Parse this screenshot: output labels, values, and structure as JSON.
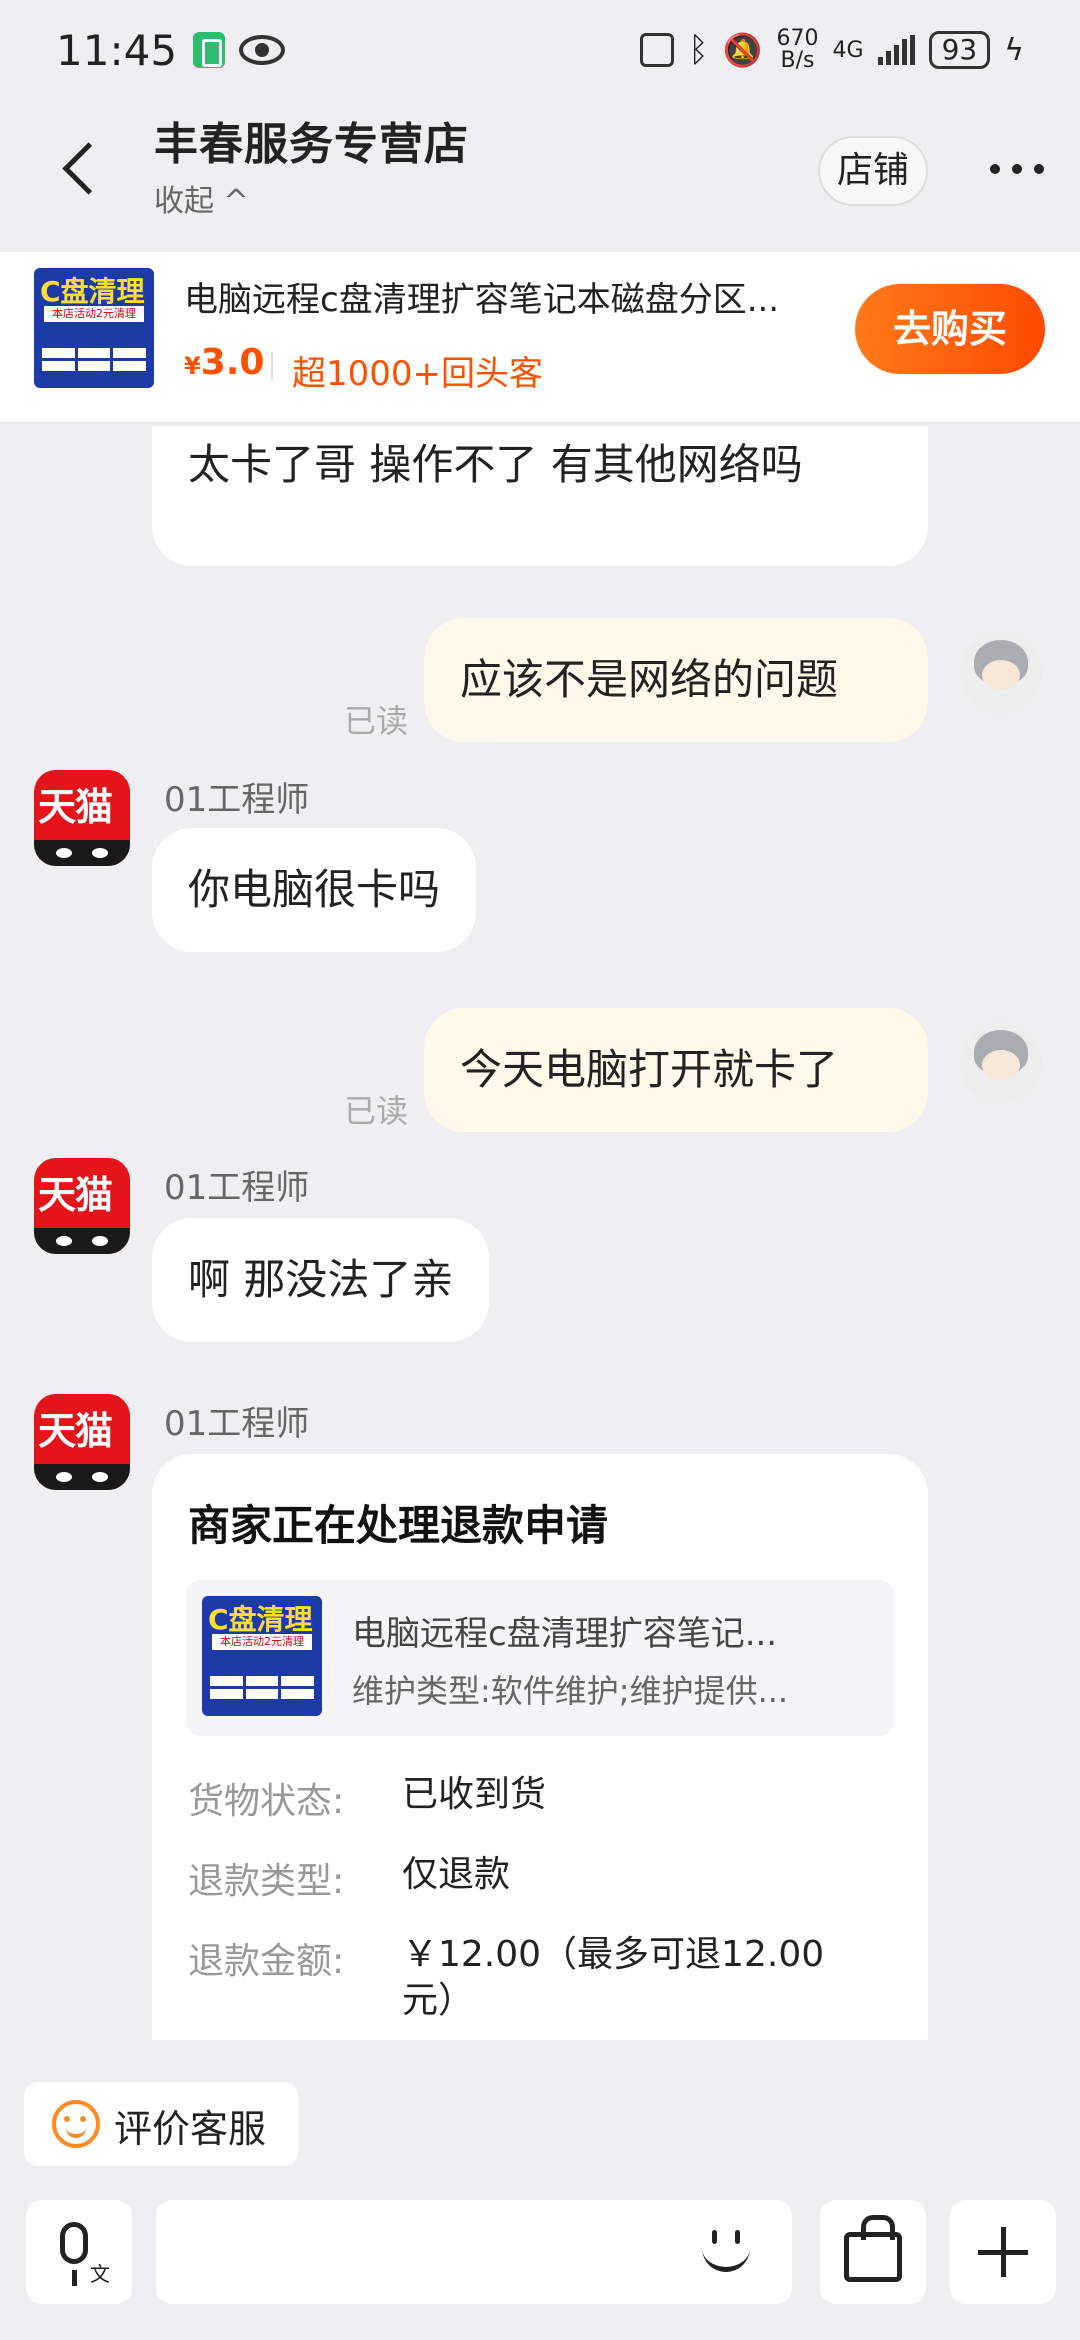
{
  "status_bar": {
    "time": "11:45",
    "net_speed_value": "670",
    "net_speed_unit": "B/s",
    "network": "4G",
    "battery": "93"
  },
  "header": {
    "title": "丰春服务专营店",
    "collapse_label": "收起 ^",
    "store_button": "店铺"
  },
  "product": {
    "thumb_title": "C盘清理",
    "thumb_sub": "本店活动2元清理",
    "title": "电脑远程c盘清理扩容笔记本磁盘分区...",
    "price_symbol": "¥",
    "price": "3.0",
    "repeat_customers": "超1000+回头客",
    "buy_button": "去购买"
  },
  "messages": [
    {
      "side": "left",
      "text": "太卡了哥  操作不了  有其他网络吗"
    },
    {
      "side": "right",
      "text": "应该不是网络的问题",
      "read": "已读"
    },
    {
      "side": "left",
      "sender": "01工程师",
      "avatar_label": "天猫",
      "text": "你电脑很卡吗"
    },
    {
      "side": "right",
      "text": "今天电脑打开就卡了",
      "read": "已读"
    },
    {
      "side": "left",
      "sender": "01工程师",
      "avatar_label": "天猫",
      "text": "啊 那没法了亲"
    },
    {
      "side": "left",
      "sender": "01工程师",
      "avatar_label": "天猫"
    }
  ],
  "refund_card": {
    "title": "商家正在处理退款申请",
    "product_title": "电脑远程c盘清理扩容笔记...",
    "product_spec": "维护类型:软件维护;维护提供...",
    "rows": [
      {
        "label": "货物状态:",
        "value": "已收到货"
      },
      {
        "label": "退款类型:",
        "value": "仅退款"
      },
      {
        "label": "退款金额:",
        "value": "￥12.00（最多可退12.00元）"
      }
    ]
  },
  "rate_button": "评价客服",
  "icons": {
    "back": "back-arrow-icon",
    "more": "more-dots-icon",
    "voice": "voice-input-icon",
    "emoji": "emoji-icon",
    "bag": "shopping-bag-icon",
    "plus": "plus-icon"
  }
}
